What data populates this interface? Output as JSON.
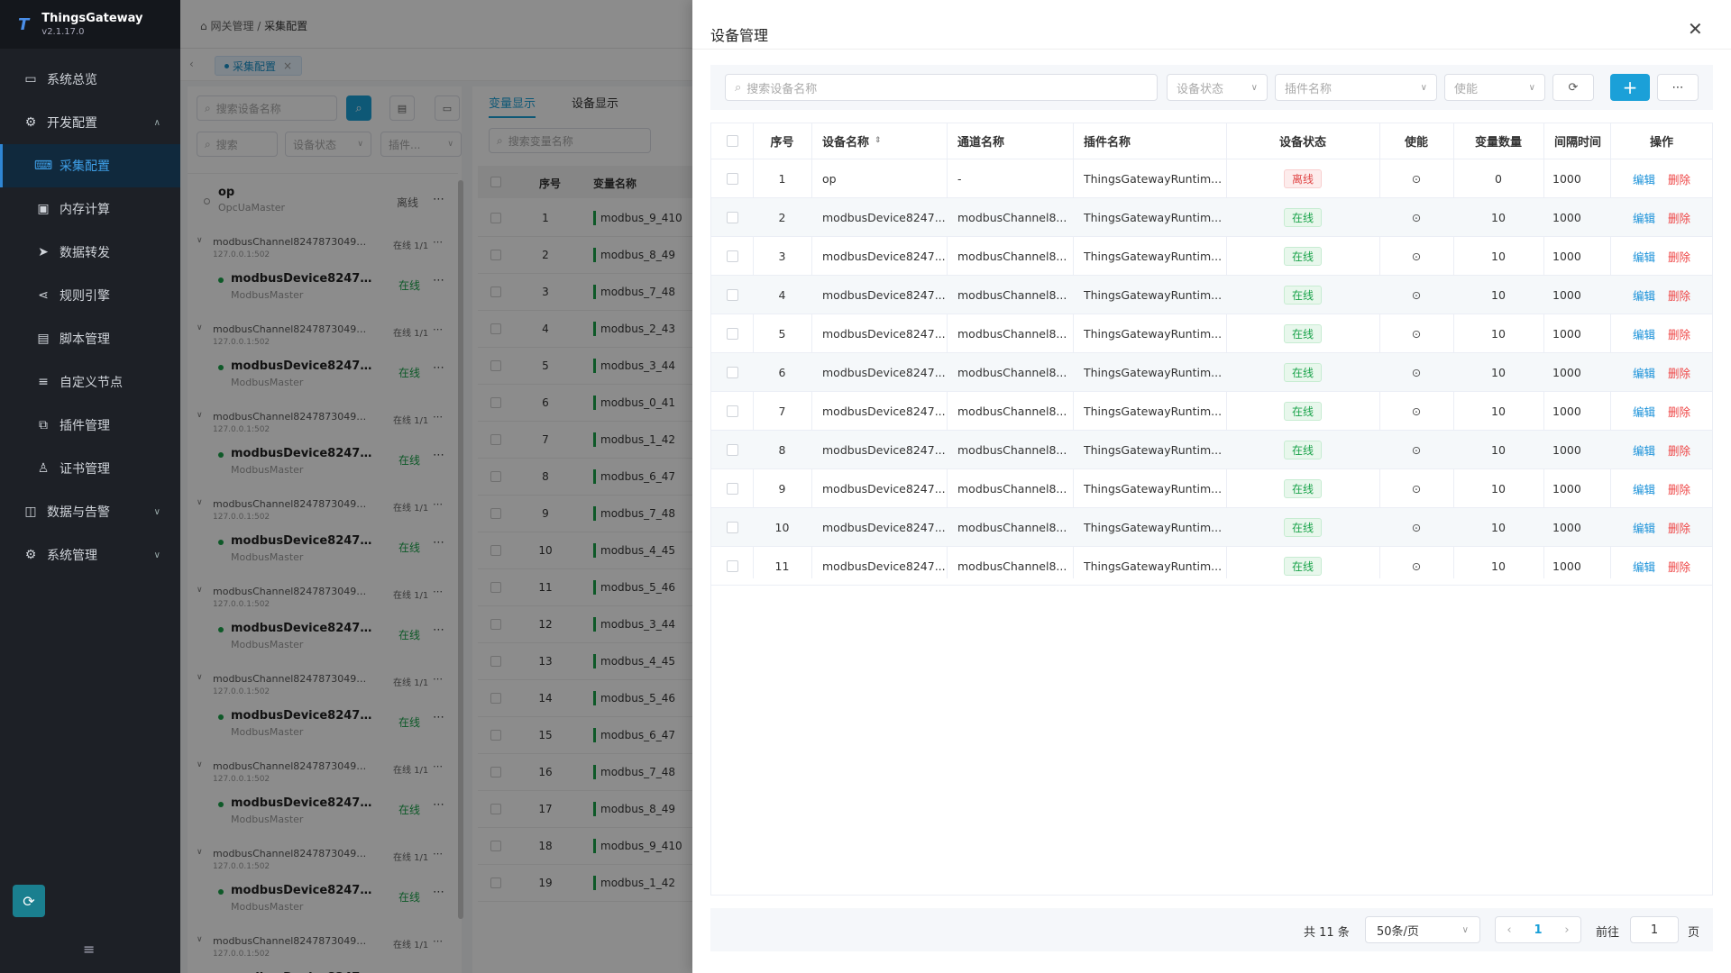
{
  "app": {
    "name": "ThingsGateway",
    "version": "v2.1.17.0"
  },
  "sidebar": {
    "items": [
      {
        "label": "系统总览",
        "icon": "monitor-icon"
      },
      {
        "label": "开发配置",
        "icon": "gear-icon"
      },
      {
        "label": "采集配置",
        "icon": "collect-icon"
      },
      {
        "label": "内存计算",
        "icon": "chip-icon"
      },
      {
        "label": "数据转发",
        "icon": "send-icon"
      },
      {
        "label": "规则引擎",
        "icon": "share-icon"
      },
      {
        "label": "脚本管理",
        "icon": "file-icon"
      },
      {
        "label": "自定义节点",
        "icon": "sliders-icon"
      },
      {
        "label": "插件管理",
        "icon": "plugin-icon"
      },
      {
        "label": "证书管理",
        "icon": "cert-icon"
      },
      {
        "label": "数据与告警",
        "icon": "alarm-icon"
      },
      {
        "label": "系统管理",
        "icon": "gear-icon"
      }
    ]
  },
  "breadcrumb": {
    "home": "网关管理",
    "sep": "/",
    "current": "采集配置"
  },
  "tabs": {
    "active": "采集配置"
  },
  "left": {
    "search_device": "搜索设备名称",
    "search": "搜索",
    "status": "设备状态",
    "plugin": "插件..."
  },
  "tree": {
    "first": {
      "name": "op",
      "plugin": "OpcUaMaster",
      "status": "离线"
    },
    "channel": {
      "name": "modbusChannel82478730493...",
      "ip": "127.0.0.1:502",
      "status": "在线 1/1"
    },
    "device": {
      "name": "modbusDevice82478730...",
      "plugin": "ModbusMaster",
      "status": "在线"
    }
  },
  "vars": {
    "tab_var": "变量显示",
    "tab_dev": "设备显示",
    "search": "搜索变量名称",
    "col_no": "序号",
    "col_name": "变量名称",
    "rows": [
      {
        "no": "1",
        "name": "modbus_9_410"
      },
      {
        "no": "2",
        "name": "modbus_8_49"
      },
      {
        "no": "3",
        "name": "modbus_7_48"
      },
      {
        "no": "4",
        "name": "modbus_2_43"
      },
      {
        "no": "5",
        "name": "modbus_3_44"
      },
      {
        "no": "6",
        "name": "modbus_0_41"
      },
      {
        "no": "7",
        "name": "modbus_1_42"
      },
      {
        "no": "8",
        "name": "modbus_6_47"
      },
      {
        "no": "9",
        "name": "modbus_7_48"
      },
      {
        "no": "10",
        "name": "modbus_4_45"
      },
      {
        "no": "11",
        "name": "modbus_5_46"
      },
      {
        "no": "12",
        "name": "modbus_3_44"
      },
      {
        "no": "13",
        "name": "modbus_4_45"
      },
      {
        "no": "14",
        "name": "modbus_5_46"
      },
      {
        "no": "15",
        "name": "modbus_6_47"
      },
      {
        "no": "16",
        "name": "modbus_7_48"
      },
      {
        "no": "17",
        "name": "modbus_8_49"
      },
      {
        "no": "18",
        "name": "modbus_9_410"
      },
      {
        "no": "19",
        "name": "modbus_1_42"
      }
    ]
  },
  "drawer": {
    "title": "设备管理",
    "search_placeholder": "搜索设备名称",
    "filter_status": "设备状态",
    "filter_plugin": "插件名称",
    "filter_enable": "使能",
    "columns": [
      "序号",
      "设备名称",
      "通道名称",
      "插件名称",
      "设备状态",
      "使能",
      "变量数量",
      "间隔时间",
      "操作"
    ],
    "rows": [
      {
        "no": "1",
        "device": "op",
        "channel": "-",
        "plugin": "ThingsGatewayRuntim...",
        "status": "离线",
        "online": false,
        "vars": "0",
        "interval": "1000"
      },
      {
        "no": "2",
        "device": "modbusDevice8247...",
        "channel": "modbusChannel8...",
        "plugin": "ThingsGatewayRuntim...",
        "status": "在线",
        "online": true,
        "vars": "10",
        "interval": "1000"
      },
      {
        "no": "3",
        "device": "modbusDevice8247...",
        "channel": "modbusChannel8...",
        "plugin": "ThingsGatewayRuntim...",
        "status": "在线",
        "online": true,
        "vars": "10",
        "interval": "1000"
      },
      {
        "no": "4",
        "device": "modbusDevice8247...",
        "channel": "modbusChannel8...",
        "plugin": "ThingsGatewayRuntim...",
        "status": "在线",
        "online": true,
        "vars": "10",
        "interval": "1000"
      },
      {
        "no": "5",
        "device": "modbusDevice8247...",
        "channel": "modbusChannel8...",
        "plugin": "ThingsGatewayRuntim...",
        "status": "在线",
        "online": true,
        "vars": "10",
        "interval": "1000"
      },
      {
        "no": "6",
        "device": "modbusDevice8247...",
        "channel": "modbusChannel8...",
        "plugin": "ThingsGatewayRuntim...",
        "status": "在线",
        "online": true,
        "vars": "10",
        "interval": "1000"
      },
      {
        "no": "7",
        "device": "modbusDevice8247...",
        "channel": "modbusChannel8...",
        "plugin": "ThingsGatewayRuntim...",
        "status": "在线",
        "online": true,
        "vars": "10",
        "interval": "1000"
      },
      {
        "no": "8",
        "device": "modbusDevice8247...",
        "channel": "modbusChannel8...",
        "plugin": "ThingsGatewayRuntim...",
        "status": "在线",
        "online": true,
        "vars": "10",
        "interval": "1000"
      },
      {
        "no": "9",
        "device": "modbusDevice8247...",
        "channel": "modbusChannel8...",
        "plugin": "ThingsGatewayRuntim...",
        "status": "在线",
        "online": true,
        "vars": "10",
        "interval": "1000"
      },
      {
        "no": "10",
        "device": "modbusDevice8247...",
        "channel": "modbusChannel8...",
        "plugin": "ThingsGatewayRuntim...",
        "status": "在线",
        "online": true,
        "vars": "10",
        "interval": "1000"
      },
      {
        "no": "11",
        "device": "modbusDevice8247...",
        "channel": "modbusChannel8...",
        "plugin": "ThingsGatewayRuntim...",
        "status": "在线",
        "online": true,
        "vars": "10",
        "interval": "1000"
      }
    ],
    "edit_label": "编辑",
    "delete_label": "删除",
    "footer": {
      "total": "共 11 条",
      "page_size": "50条/页",
      "current_page": "1",
      "goto_label": "前往",
      "goto_value": "1",
      "page_unit": "页"
    }
  },
  "colors": {
    "accent": "#1ba0d8",
    "online": "#1aa34a",
    "offline": "#e04646",
    "sidebar": "#1d2026"
  }
}
